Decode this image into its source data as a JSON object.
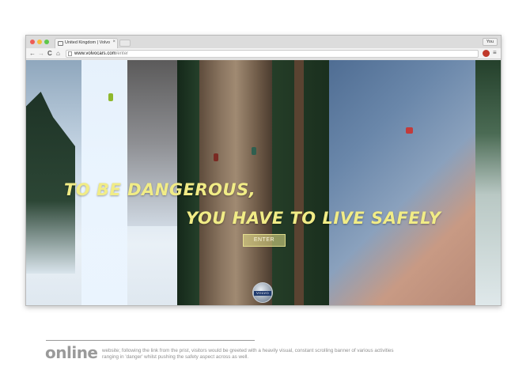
{
  "browser": {
    "tab_title": "United Kingdom | Volvo Ca",
    "tab_close": "×",
    "user_badge": "You",
    "nav": {
      "back": "←",
      "forward": "→",
      "reload": "C",
      "home": "⌂",
      "menu": "≡"
    },
    "address": {
      "host": "www.volvocars.com",
      "path": "/enter"
    }
  },
  "page": {
    "headline_line1": "TO BE DANGEROUS,",
    "headline_line2": "YOU HAVE TO LIVE SAFELY",
    "enter_label": "ENTER",
    "logo_text": "VOLVO"
  },
  "caption": {
    "label": "online",
    "text": "website; following the link from the prist, visitors would be greeted with a heavily visual, constant scrolling banner of various activities ranging in 'danger' whilst pushing the safety aspect across as well."
  },
  "colors": {
    "headline": "#f1ec86",
    "caption": "#9a9a9a"
  }
}
